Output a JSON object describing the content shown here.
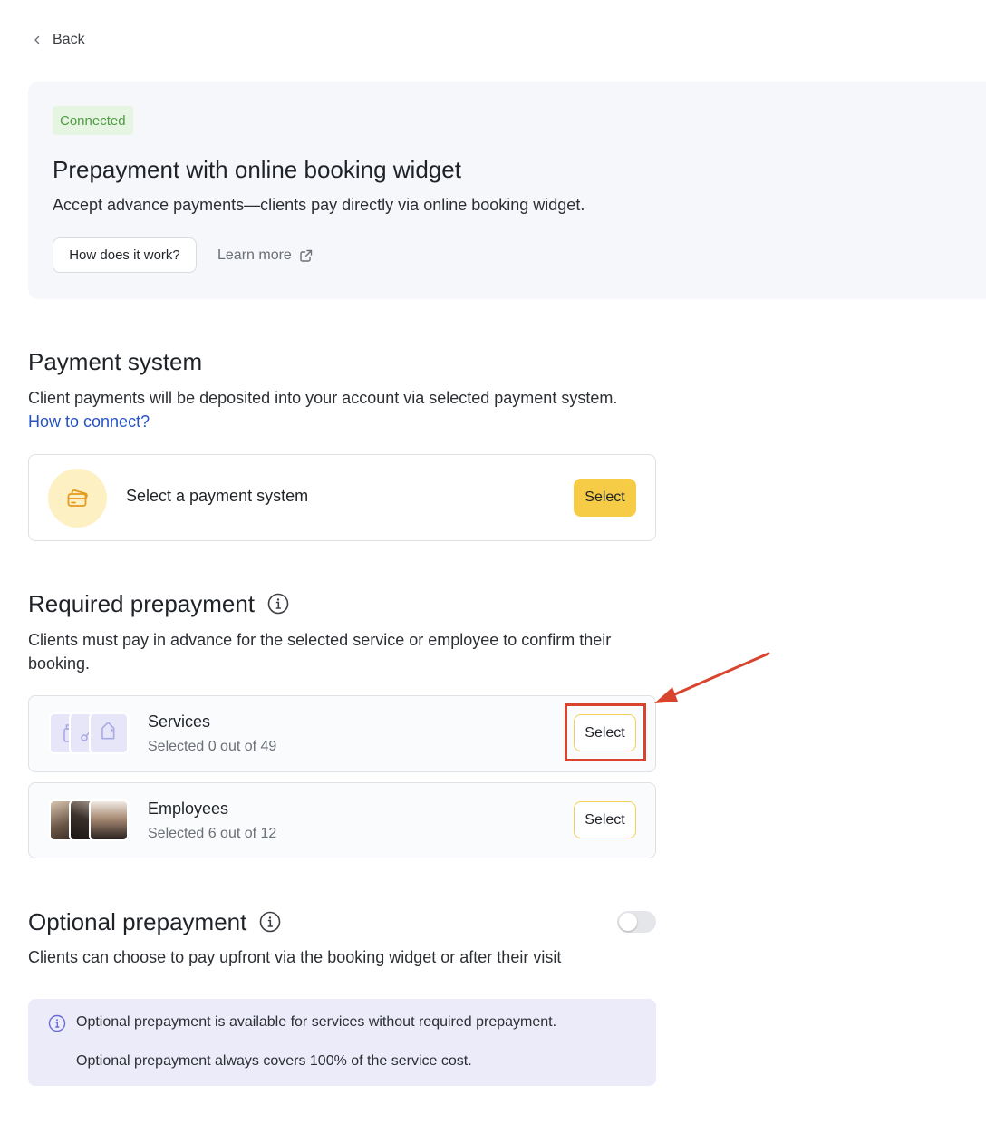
{
  "nav": {
    "back_label": "Back"
  },
  "hero": {
    "badge": "Connected",
    "title": "Prepayment with online booking widget",
    "description": "Accept advance payments—clients pay directly via online booking widget.",
    "how_button": "How does it work?",
    "learn_more": "Learn more"
  },
  "payment_system": {
    "title": "Payment system",
    "description": "Client payments will be deposited into your account via selected payment system.",
    "link": "How to connect?",
    "card_label": "Select a payment system",
    "select_button": "Select"
  },
  "required_prepayment": {
    "title": "Required prepayment",
    "description": "Clients must pay in advance for the selected service or employee to confirm their booking.",
    "rows": [
      {
        "title": "Services",
        "subtitle": "Selected 0 out of 49",
        "button": "Select"
      },
      {
        "title": "Employees",
        "subtitle": "Selected 6 out of 12",
        "button": "Select"
      }
    ]
  },
  "optional_prepayment": {
    "title": "Optional prepayment",
    "description": "Clients can choose to pay upfront via the booking widget or after their visit",
    "toggle_on": false,
    "note_lines": [
      "Optional prepayment is available for services without required prepayment.",
      "Optional prepayment always covers 100% of the service cost."
    ]
  },
  "colors": {
    "accent_yellow": "#f6cb45",
    "link_blue": "#2653c4",
    "badge_green": "#4f9a43",
    "annotation_red": "#d9442f"
  }
}
